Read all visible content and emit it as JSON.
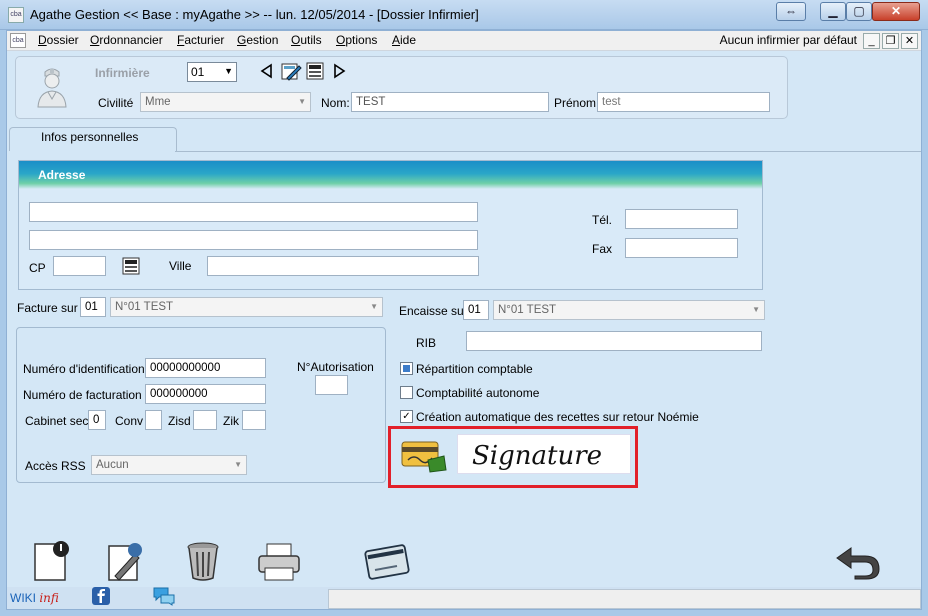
{
  "window": {
    "title": "Agathe Gestion << Base : myAgathe >>   --   lun. 12/05/2014  - [Dossier Infirmier]",
    "icon_text": "cba"
  },
  "menubar": {
    "items": [
      "Dossier",
      "Ordonnancier",
      "Facturier",
      "Gestion",
      "Outils",
      "Options",
      "Aide"
    ],
    "right_text": "Aucun infirmier par défaut"
  },
  "header": {
    "infirmiere_label": "Infirmière",
    "number": "01",
    "civilite_label": "Civilité",
    "civilite_value": "Mme",
    "nom_label": "Nom:",
    "nom_value": "TEST",
    "prenom_label": "Prénom",
    "prenom_value": "test"
  },
  "tabs": [
    {
      "label": "Infos personnelles"
    }
  ],
  "adresse": {
    "title": "Adresse",
    "line1": "",
    "line2": "",
    "cp_label": "CP",
    "cp_value": "",
    "ville_label": "Ville",
    "ville_value": "",
    "tel_label": "Tél.",
    "tel_value": "",
    "fax_label": "Fax",
    "fax_value": ""
  },
  "facture": {
    "label": "Facture sur",
    "code": "01",
    "value": "N°01 TEST"
  },
  "encaisse": {
    "label": "Encaisse sur",
    "code": "01",
    "value": "N°01 TEST"
  },
  "rib": {
    "label": "RIB",
    "value": ""
  },
  "identification": {
    "num_id_label": "Numéro d'identification",
    "num_id_value": "00000000000",
    "num_fact_label": "Numéro de facturation",
    "num_fact_value": "000000000",
    "autorisation_label": "N°Autorisation",
    "autorisation_value": "",
    "cabinet_label": "Cabinet sec.",
    "cabinet_value": "0",
    "conv_label": "Conv",
    "conv_value": "",
    "zisd_label": "Zisd",
    "zisd_value": "",
    "zik_label": "Zik",
    "zik_value": "",
    "rss_label": "Accès RSS",
    "rss_value": "Aucun"
  },
  "options": [
    {
      "label": "Répartition comptable",
      "state": "indeterminate"
    },
    {
      "label": "Comptabilité autonome",
      "state": "unchecked"
    },
    {
      "label": "Création automatique des recettes sur retour Noémie",
      "state": "checked"
    }
  ],
  "signature": {
    "text": "Signature"
  },
  "footer": {
    "wiki": "WIKI",
    "wiki_suffix": "infi"
  },
  "colors": {
    "highlight": "#e2202a",
    "accent": "#1a8ec8"
  }
}
